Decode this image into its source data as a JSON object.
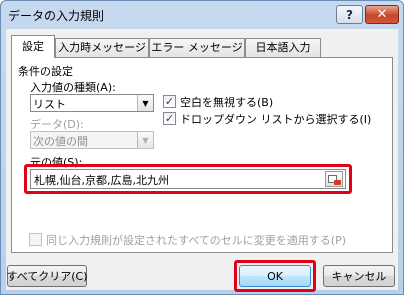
{
  "window": {
    "title": "データの入力規則",
    "help_label": "?",
    "close_label": "✕"
  },
  "tabs": [
    {
      "label": "設定",
      "active": true
    },
    {
      "label": "入力時メッセージ",
      "active": false
    },
    {
      "label": "エラー メッセージ",
      "active": false
    },
    {
      "label": "日本語入力",
      "active": false
    }
  ],
  "settings": {
    "group_label": "条件の設定",
    "allow_label": "入力値の種類(A):",
    "allow_value": "リスト",
    "data_label": "データ(D):",
    "data_value": "次の値の間",
    "ignore_blank_label": "空白を無視する(B)",
    "ignore_blank_checked": true,
    "in_cell_dropdown_label": "ドロップダウン リストから選択する(I)",
    "in_cell_dropdown_checked": true,
    "source_label": "元の値(S):",
    "source_value": "札幌,仙台,京都,広島,北九州",
    "apply_all_label": "同じ入力規則が設定されたすべてのセルに変更を適用する(P)",
    "apply_all_checked": false
  },
  "buttons": {
    "clear_all": "すべてクリア(C)",
    "ok": "OK",
    "cancel": "キャンセル"
  },
  "icons": {
    "dropdown_arrow": "▼",
    "checkmark": "✓",
    "range_select": "collapse-dialog-icon"
  },
  "colors": {
    "highlight": "#e00018",
    "titlebar": "#c6d9ef",
    "close_button": "#c6462a"
  }
}
